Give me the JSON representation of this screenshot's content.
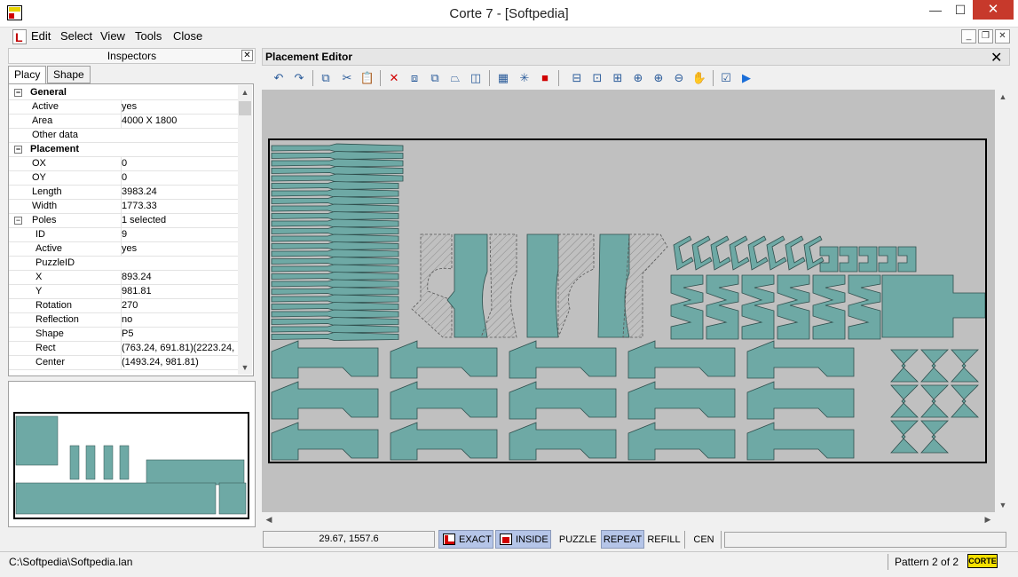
{
  "window": {
    "title": "Corte 7 - [Softpedia]",
    "min": "—",
    "max": "☐",
    "close": "✕"
  },
  "menu": {
    "items": [
      "Edit",
      "Select",
      "View",
      "Tools",
      "Close"
    ],
    "mdi_min": "_",
    "mdi_restore": "❐",
    "mdi_close": "✕"
  },
  "inspectors": {
    "title": "Inspectors",
    "tabs": [
      "Placy",
      "Shape"
    ],
    "properties": [
      {
        "key": "General",
        "value": "",
        "type": "group",
        "expand": "−"
      },
      {
        "key": "Active",
        "value": "yes"
      },
      {
        "key": "Area",
        "value": "4000 X 1800"
      },
      {
        "key": "Other data",
        "value": ""
      },
      {
        "key": "Placement",
        "value": "",
        "type": "group",
        "expand": "−"
      },
      {
        "key": "OX",
        "value": "0"
      },
      {
        "key": "OY",
        "value": "0"
      },
      {
        "key": "Length",
        "value": "3983.24"
      },
      {
        "key": "Width",
        "value": "1773.33"
      },
      {
        "key": "Poles",
        "value": "1 selected",
        "type": "expandable",
        "expand": "−"
      },
      {
        "key": "ID",
        "value": "9",
        "type": "sub"
      },
      {
        "key": "Active",
        "value": "yes",
        "type": "sub"
      },
      {
        "key": "PuzzleID",
        "value": "",
        "type": "sub"
      },
      {
        "key": "X",
        "value": "893.24",
        "type": "sub"
      },
      {
        "key": "Y",
        "value": "981.81",
        "type": "sub"
      },
      {
        "key": "Rotation",
        "value": "270",
        "type": "sub"
      },
      {
        "key": "Reflection",
        "value": "no",
        "type": "sub"
      },
      {
        "key": "Shape",
        "value": "P5",
        "type": "sub"
      },
      {
        "key": "Rect",
        "value": "(763.24, 691.81)(2223.24,",
        "type": "sub"
      },
      {
        "key": "Center",
        "value": "(1493.24, 981.81)",
        "type": "sub"
      }
    ]
  },
  "editor": {
    "title": "Placement Editor",
    "close": "✕"
  },
  "status": {
    "coords": "29.67, 1557.6",
    "exact": "EXACT",
    "inside": "INSIDE",
    "puzzle": "PUZZLE",
    "repeat": "REPEAT",
    "refill": "REFILL",
    "cen": "CEN",
    "path": "C:\\Softpedia\\Softpedia.lan",
    "pattern": "Pattern 2 of 2",
    "logo": "CORTE"
  },
  "colors": {
    "piece_fill": "#6ea9a5",
    "piece_stroke": "#2f4f4d",
    "canvas_bg": "#c0c0c0",
    "accent_red": "#d00000",
    "status_active": "#b5c5e8"
  },
  "toolbar_icons": [
    "undo-icon",
    "redo-icon",
    "copy-icon",
    "cut-icon",
    "paste-icon",
    "delete-icon",
    "group-icon",
    "ungroup-icon",
    "flip-icon",
    "mirror-icon",
    "grid-icon",
    "center-icon",
    "corte-icon",
    "zoom-fit-icon",
    "zoom-page-icon",
    "zoom-area-icon",
    "zoom-in-icon",
    "zoom-plus-icon",
    "zoom-minus-icon",
    "pan-hand-icon",
    "check-icon",
    "play-icon"
  ]
}
